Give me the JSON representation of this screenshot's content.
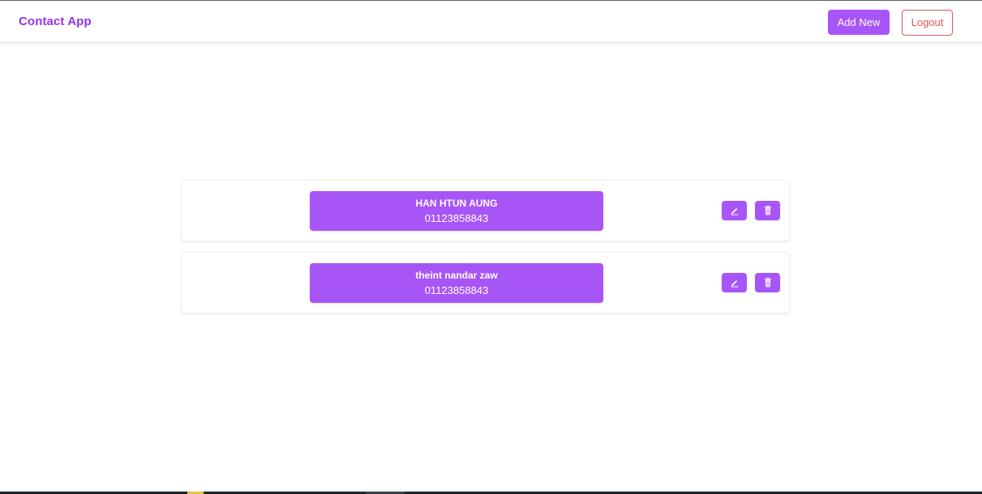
{
  "navbar": {
    "brand": "Contact App",
    "add_new_label": "Add New",
    "logout_label": "Logout"
  },
  "contacts": [
    {
      "name": "HAN HTUN AUNG",
      "phone": "01123858843"
    },
    {
      "name": "theint nandar zaw",
      "phone": "01123858843"
    }
  ],
  "icons": {
    "edit": "pencil-icon",
    "delete": "trash-icon"
  },
  "colors": {
    "brand": "#9333ea",
    "accent": "#a855f7",
    "logout": "#e0565b"
  }
}
